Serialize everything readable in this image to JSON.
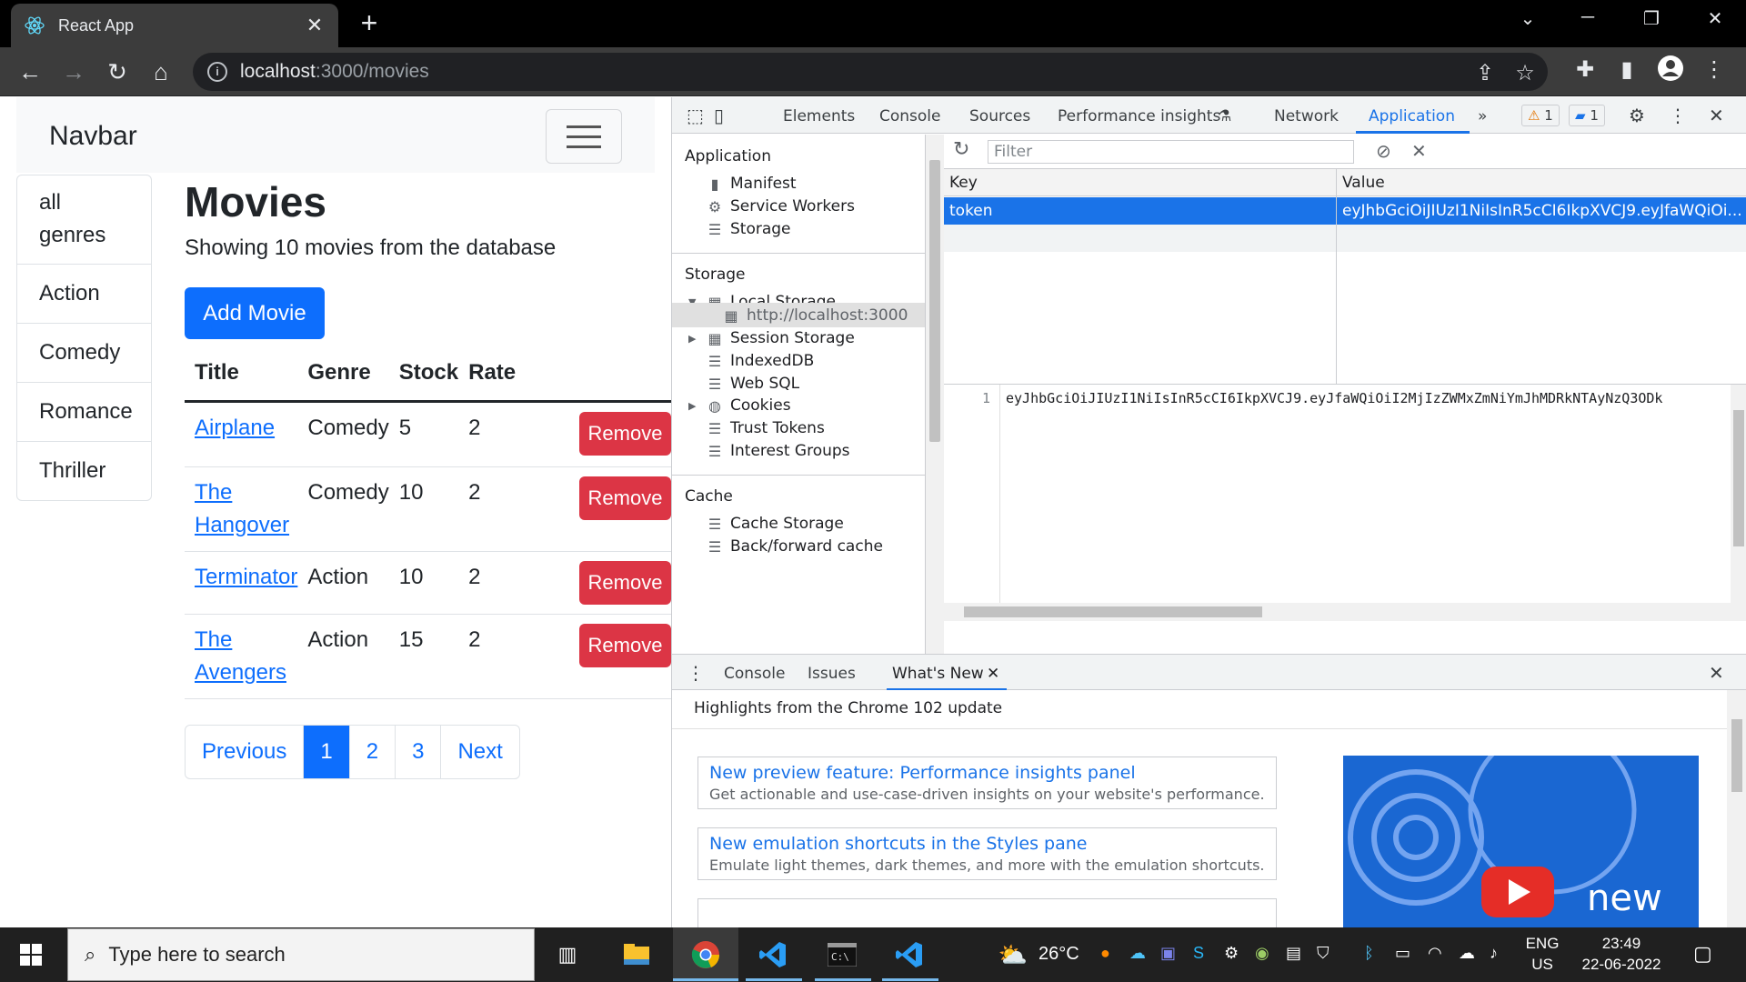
{
  "browser": {
    "tab_title": "React App",
    "url_host": "localhost",
    "url_path": ":3000/movies"
  },
  "app": {
    "brand": "Navbar",
    "genres": [
      "all genres",
      "Action",
      "Comedy",
      "Romance",
      "Thriller"
    ],
    "heading": "Movies",
    "subtitle": "Showing 10 movies from the database",
    "add_button": "Add Movie",
    "columns": [
      "Title",
      "Genre",
      "Stock",
      "Rate"
    ],
    "movies": [
      {
        "title": "Airplane",
        "genre": "Comedy",
        "stock": "5",
        "rate": "2"
      },
      {
        "title": "The Hangover",
        "genre": "Comedy",
        "stock": "10",
        "rate": "2"
      },
      {
        "title": "Terminator",
        "genre": "Action",
        "stock": "10",
        "rate": "2"
      },
      {
        "title": "The Avengers",
        "genre": "Action",
        "stock": "15",
        "rate": "2"
      }
    ],
    "remove_label": "Remove",
    "pagination": {
      "previous": "Previous",
      "pages": [
        "1",
        "2",
        "3"
      ],
      "active_page": "1",
      "next": "Next"
    }
  },
  "devtools": {
    "tabs": [
      "Elements",
      "Console",
      "Sources",
      "Performance insights",
      "Network",
      "Application"
    ],
    "selected_tab": "Application",
    "warnings": "1",
    "messages": "1",
    "sidebar": {
      "application_title": "Application",
      "application_items": [
        "Manifest",
        "Service Workers",
        "Storage"
      ],
      "storage_title": "Storage",
      "local_storage": "Local Storage",
      "local_storage_origin": "http://localhost:3000",
      "session_storage": "Session Storage",
      "indexeddb": "IndexedDB",
      "websql": "Web SQL",
      "cookies": "Cookies",
      "trust_tokens": "Trust Tokens",
      "interest_groups": "Interest Groups",
      "cache_title": "Cache",
      "cache_storage": "Cache Storage",
      "bfcache": "Back/forward cache"
    },
    "filter_placeholder": "Filter",
    "kv_headers": {
      "key": "Key",
      "value": "Value"
    },
    "selected_entry": {
      "key": "token",
      "value": "eyJhbGciOiJIUzI1NiIsInR5cCI6IkpXVCJ9.eyJfaWQiOi..."
    },
    "editor": {
      "line": "1",
      "text": "eyJhbGciOiJIUzI1NiIsInR5cCI6IkpXVCJ9.eyJfaWQiOiI2MjIzZWMxZmNiYmJhMDRkNTAyNzQ3ODk"
    },
    "drawer": {
      "tabs": [
        "Console",
        "Issues",
        "What's New"
      ],
      "selected": "What's New",
      "headline": "Highlights from the Chrome 102 update",
      "cards": [
        {
          "title": "New preview feature: Performance insights panel",
          "desc": "Get actionable and use-case-driven insights on your website's performance."
        },
        {
          "title": "New emulation shortcuts in the Styles pane",
          "desc": "Emulate light themes, dark themes, and more with the emulation shortcuts."
        }
      ],
      "thumb_text": "new"
    }
  },
  "taskbar": {
    "search_placeholder": "Type here to search",
    "weather": "26°C",
    "lang_top": "ENG",
    "lang_bottom": "US",
    "time": "23:49",
    "date": "22-06-2022"
  },
  "colors": {
    "bootstrap_primary": "#0d6efd",
    "bootstrap_danger": "#dc3545",
    "devtools_blue": "#1a73e8"
  }
}
